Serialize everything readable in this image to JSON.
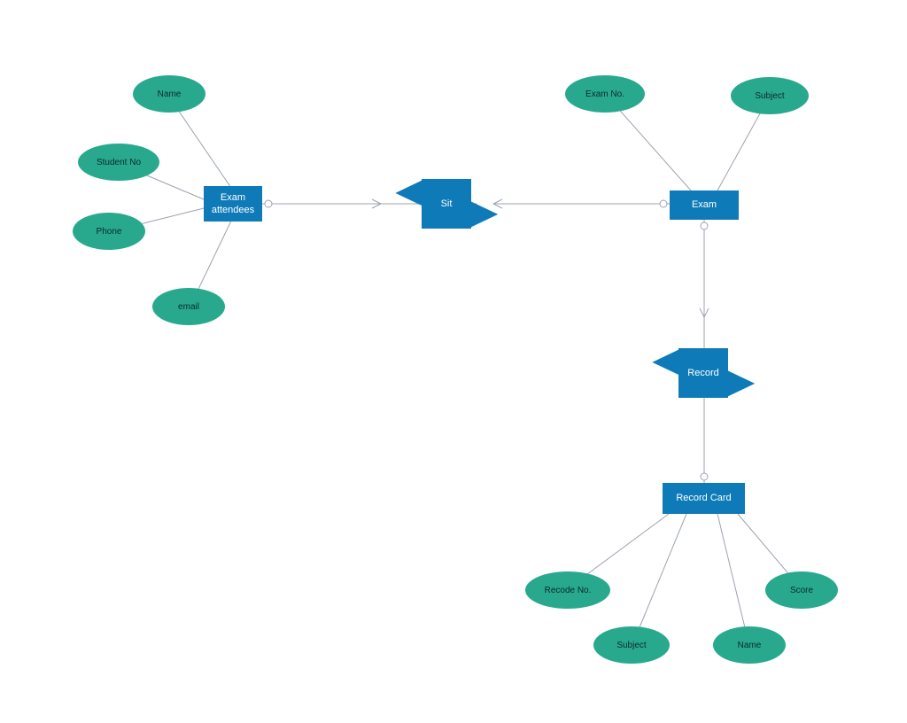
{
  "entities": {
    "examAttendees": {
      "label": "Exam\nattendees"
    },
    "exam": {
      "label": "Exam"
    },
    "recordCard": {
      "label": "Record Card"
    }
  },
  "relationships": {
    "sit": {
      "label": "Sit"
    },
    "record": {
      "label": "Record"
    }
  },
  "attributes": {
    "name1": {
      "label": "Name"
    },
    "studentNo": {
      "label": "Student No"
    },
    "phone": {
      "label": "Phone"
    },
    "email": {
      "label": "email"
    },
    "examNo": {
      "label": "Exam No."
    },
    "subject1": {
      "label": "Subject"
    },
    "recodeNo": {
      "label": "Recode No."
    },
    "subject2": {
      "label": "Subject"
    },
    "name2": {
      "label": "Name"
    },
    "score": {
      "label": "Score"
    }
  }
}
